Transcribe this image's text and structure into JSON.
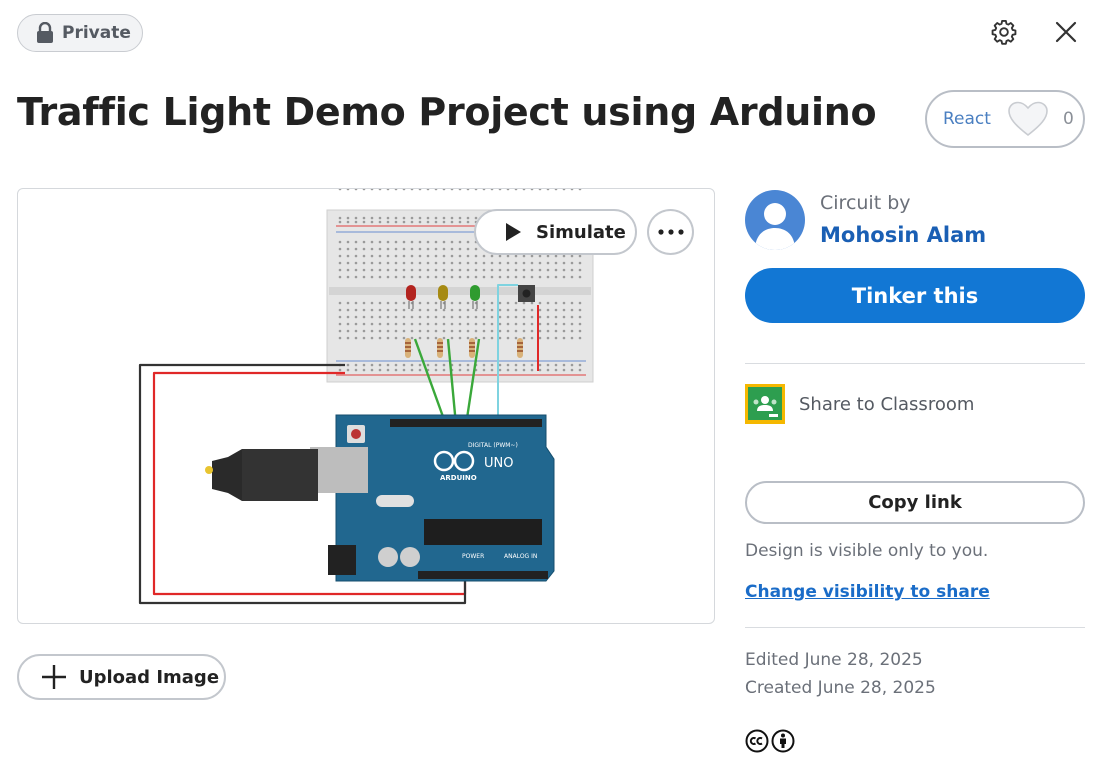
{
  "header": {
    "privacy_label": "Private",
    "settings_icon": "gear-icon",
    "close_icon": "close-icon"
  },
  "project": {
    "title": "Traffic Light Demo Project using Arduino"
  },
  "react": {
    "label": "React",
    "count": "0",
    "icon": "heart-icon"
  },
  "preview": {
    "simulate_label": "Simulate",
    "board_logo": "ARDUINO",
    "board_model": "UNO",
    "digital_label": "DIGITAL (PWM~)",
    "power_label": "POWER",
    "analog_label": "ANALOG IN",
    "led_colors": [
      "#b3241f",
      "#a68a12",
      "#2f9b2f"
    ]
  },
  "upload": {
    "label": "Upload Image"
  },
  "author": {
    "circuit_by": "Circuit by",
    "name": "Mohosin Alam"
  },
  "actions": {
    "tinker_label": "Tinker this",
    "classroom_label": "Share to Classroom",
    "copy_link_label": "Copy link",
    "visibility_note": "Design is visible only to you.",
    "change_visibility_label": "Change visibility to share"
  },
  "meta": {
    "edited": "Edited June 28, 2025",
    "created": "Created June 28, 2025"
  },
  "colors": {
    "primary": "#1277d4",
    "link": "#1a5fb4",
    "classroom_green": "#2d9e4f",
    "classroom_yellow": "#f5b800"
  }
}
